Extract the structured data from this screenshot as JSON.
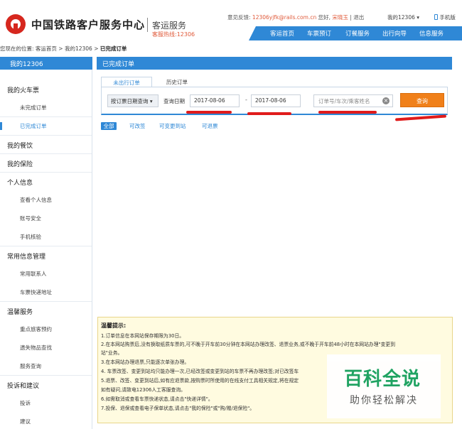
{
  "header": {
    "site_title": "中国铁路客户服务中心",
    "sub_title": "客运服务",
    "hotline": "客服热线:12306",
    "feedback_label": "意见反馈:",
    "feedback_email": "12306yjfk@rails.com.cn",
    "greeting": "您好,",
    "user_name": "宋晓玉",
    "logout": "退出",
    "my12306": "我的12306",
    "mobile": "手机版",
    "nav": [
      "客运首页",
      "车票预订",
      "订餐服务",
      "出行向导",
      "信息服务"
    ]
  },
  "breadcrumb": {
    "prefix": "您现在的位置: 客运首页 > 我的12306 >",
    "current": "已完成订单"
  },
  "sidebar": {
    "title": "我的12306",
    "items": [
      {
        "label": "我的火车票",
        "kind": "cat"
      },
      {
        "label": "未完成订单",
        "kind": "sub"
      },
      {
        "label": "已完成订单",
        "kind": "sub",
        "active": true
      },
      {
        "label": "我的餐饮",
        "kind": "cat"
      },
      {
        "label": "我的保险",
        "kind": "cat"
      },
      {
        "label": "个人信息",
        "kind": "cat"
      },
      {
        "label": "查看个人信息",
        "kind": "sub"
      },
      {
        "label": "账号安全",
        "kind": "sub"
      },
      {
        "label": "手机核验",
        "kind": "sub"
      },
      {
        "label": "常用信息管理",
        "kind": "cat"
      },
      {
        "label": "常用联系人",
        "kind": "sub"
      },
      {
        "label": "车票快递地址",
        "kind": "sub"
      },
      {
        "label": "温馨服务",
        "kind": "cat"
      },
      {
        "label": "重点旅客预约",
        "kind": "sub"
      },
      {
        "label": "遗失物品查找",
        "kind": "sub"
      },
      {
        "label": "服务查询",
        "kind": "sub"
      },
      {
        "label": "投诉和建议",
        "kind": "cat"
      },
      {
        "label": "投诉",
        "kind": "sub"
      },
      {
        "label": "建议",
        "kind": "sub"
      }
    ]
  },
  "main": {
    "title": "已完成订单",
    "tabs": [
      "未出行订单",
      "历史订单"
    ],
    "filter": {
      "select_value": "按订票日期查询",
      "date_label": "查询日期",
      "date_from": "2017-08-06",
      "date_to": "2017-08-06",
      "search_placeholder": "订单号/车次/乘客姓名",
      "query_button": "查询"
    },
    "chips": [
      "全部",
      "可改签",
      "可变更到站",
      "可退票"
    ]
  },
  "tips": {
    "title": "温馨提示:",
    "lines": [
      "1.订单信息在本网站保存期限为30日。",
      "2.在本网站购票后,没有换取纸质车票的,可不晚于开车前30分钟在本网站办理改签、退票业务,或不晚于开车前48小时在本网站办理\"变更到",
      "站\"业务。",
      "3.在本网站办理退票,只能逐次单张办理。",
      "4. 车票改签、变更到站均只能办理一次,已经改签或变更到站的车票不再办理改签;对已改签车",
      "5.退票、改签、变更到站后,如有应退票款,按购票时所使用的在线支付工具相关规定,将在规定",
      "如有疑问,请致电12306人工客服查询。",
      "6.如需取消或查看车票快递状态,请点击\"快递详情\"。",
      "7.投保、退保或查看电子保单状态,请点击\"我的保险\"或\"购/赠/退保险\"。"
    ]
  },
  "watermark": {
    "brand": "百科全说",
    "slogan": "助你轻松解决"
  },
  "colors": {
    "brand_blue": "#2f88d6",
    "logo_red": "#d6271e",
    "query_orange": "#f0801a",
    "annotation_red": "#e01b1b",
    "watermark_green": "#17a05d"
  }
}
